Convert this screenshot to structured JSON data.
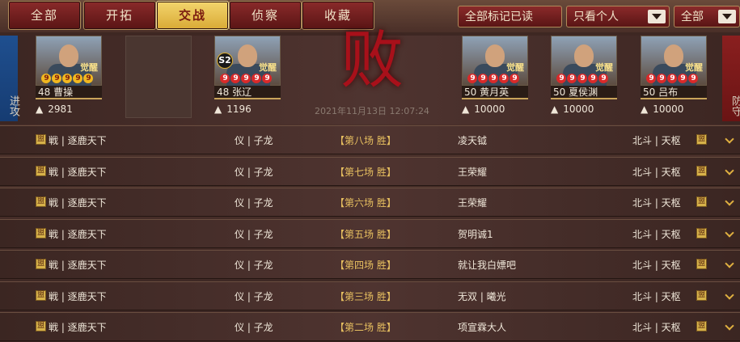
{
  "tabs": [
    "全部",
    "开拓",
    "交战",
    "侦察",
    "收藏"
  ],
  "active_tab": 2,
  "toolbar": {
    "mark_all_read": "全部标记已读",
    "filter_self": "只看个人",
    "filter_all": "全部"
  },
  "sides": {
    "attack": "进攻",
    "defend": "防守"
  },
  "result_char": "败",
  "timestamp": "2021年11月13日 12:07:24",
  "attackers": [
    {
      "name": "48 曹操",
      "awaken": "觉醒",
      "troops": "2981",
      "stars": [
        "9",
        "9",
        "9",
        "9",
        "9"
      ],
      "red_stars": 0,
      "s2": ""
    },
    {
      "name": "48 张辽",
      "awaken": "觉醒",
      "troops": "1196",
      "stars": [
        "9",
        "9",
        "9",
        "9",
        "9"
      ],
      "red_stars": 5,
      "s2": "S2"
    }
  ],
  "defenders": [
    {
      "name": "50 黄月英",
      "awaken": "觉醒",
      "troops": "10000",
      "stars": [
        "9",
        "9",
        "9",
        "9",
        "9"
      ],
      "red_stars": 5
    },
    {
      "name": "50 夏侯渊",
      "awaken": "觉醒",
      "troops": "10000",
      "stars": [
        "9",
        "9",
        "9",
        "9",
        "9"
      ],
      "red_stars": 5
    },
    {
      "name": "50 吕布",
      "awaken": "觉醒",
      "troops": "10000",
      "stars": [
        "9",
        "9",
        "9",
        "9",
        "9"
      ],
      "red_stars": 5
    }
  ],
  "badge_char": "盟",
  "reports": [
    {
      "left_name": "戦 | 逐鹿天下",
      "left_alliance": "仪 | 子龙",
      "result": "【第八场 胜】",
      "right_name": "凌天钺",
      "right_alliance": "北斗 | 天枢"
    },
    {
      "left_name": "戦 | 逐鹿天下",
      "left_alliance": "仪 | 子龙",
      "result": "【第七场 胜】",
      "right_name": "王荣耀",
      "right_alliance": "北斗 | 天枢"
    },
    {
      "left_name": "戦 | 逐鹿天下",
      "left_alliance": "仪 | 子龙",
      "result": "【第六场 胜】",
      "right_name": "王荣耀",
      "right_alliance": "北斗 | 天枢"
    },
    {
      "left_name": "戦 | 逐鹿天下",
      "left_alliance": "仪 | 子龙",
      "result": "【第五场 胜】",
      "right_name": "贺明诚1",
      "right_alliance": "北斗 | 天枢"
    },
    {
      "left_name": "戦 | 逐鹿天下",
      "left_alliance": "仪 | 子龙",
      "result": "【第四场 胜】",
      "right_name": "就让我白嫖吧",
      "right_alliance": "北斗 | 天枢"
    },
    {
      "left_name": "戦 | 逐鹿天下",
      "left_alliance": "仪 | 子龙",
      "result": "【第三场 胜】",
      "right_name": "无双 | 曦光",
      "right_alliance": "北斗 | 天枢"
    },
    {
      "left_name": "戦 | 逐鹿天下",
      "left_alliance": "仪 | 子龙",
      "result": "【第二场 胜】",
      "right_name": "项宣霖大人",
      "right_alliance": "北斗 | 天枢"
    }
  ]
}
